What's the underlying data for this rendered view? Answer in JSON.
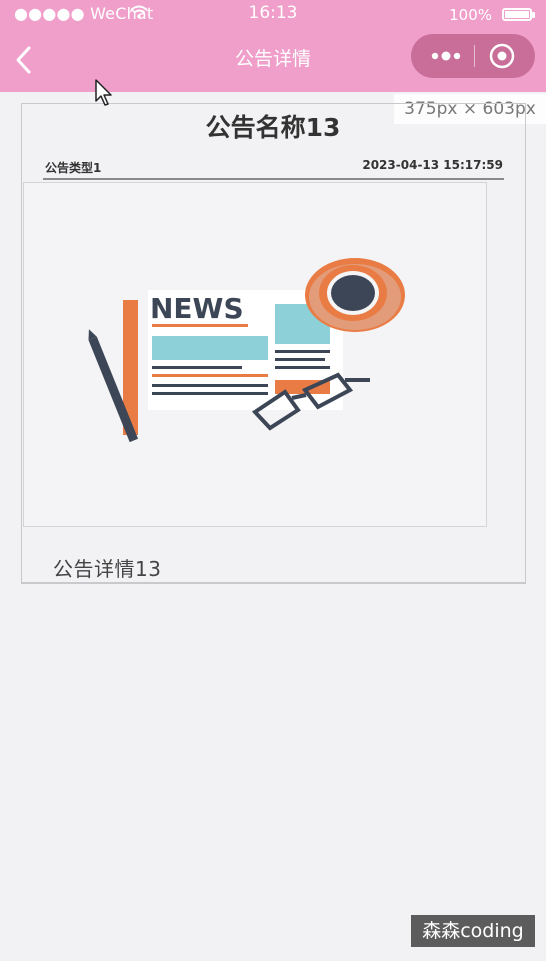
{
  "status_bar": {
    "carrier": "●●●●● WeChat",
    "time": "16:13",
    "battery": "100%"
  },
  "nav": {
    "title": "公告详情"
  },
  "overlay": {
    "size_label": "375px × 603px"
  },
  "notice": {
    "title": "公告名称13",
    "type": "公告类型1",
    "datetime": "2023-04-13 15:17:59",
    "image_headline": "NEWS",
    "detail": "公告详情13"
  },
  "watermark": "森森coding",
  "colors": {
    "nav_bg": "#ef9fca",
    "capsule_bg": "#c86e98",
    "page_bg": "#f2f2f4"
  }
}
